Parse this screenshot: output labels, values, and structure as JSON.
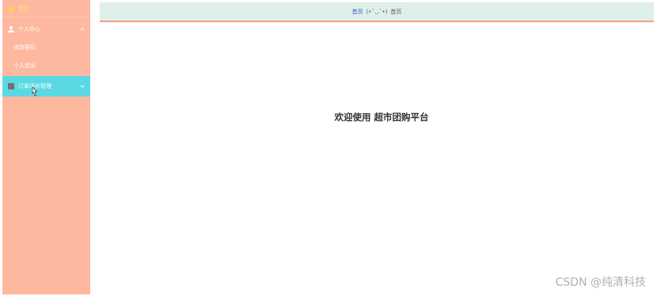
{
  "sidebar": {
    "home_label": "首页",
    "personal_center": {
      "label": "个人中心",
      "items": [
        {
          "label": "修改密码"
        },
        {
          "label": "个人信息"
        }
      ]
    },
    "order_management": {
      "label": "订单评价管理"
    }
  },
  "header": {
    "breadcrumb_home": "首页",
    "breadcrumb_separator": "(•ˇ◡ˇ•)",
    "breadcrumb_current": "首页"
  },
  "main": {
    "welcome_text": "欢迎使用 超市团购平台"
  },
  "watermark": "CSDN @纯清科技",
  "colors": {
    "sidebar_bg": "#ffb8a0",
    "active_item_bg": "#5bd9e3",
    "header_bg": "#dff0e8",
    "header_border": "#ff9a86",
    "home_label_color": "#ffe86a"
  },
  "icons": {
    "home": "home-icon",
    "personal_center": "user-icon",
    "order_management": "order-icon"
  }
}
